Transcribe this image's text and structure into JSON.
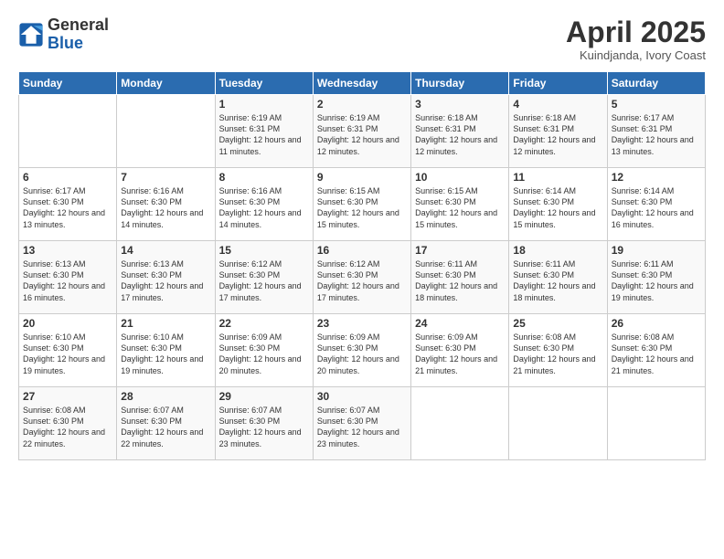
{
  "header": {
    "logo_general": "General",
    "logo_blue": "Blue",
    "month_title": "April 2025",
    "location": "Kuindjanda, Ivory Coast"
  },
  "days_of_week": [
    "Sunday",
    "Monday",
    "Tuesday",
    "Wednesday",
    "Thursday",
    "Friday",
    "Saturday"
  ],
  "weeks": [
    [
      {
        "day": "",
        "info": ""
      },
      {
        "day": "",
        "info": ""
      },
      {
        "day": "1",
        "info": "Sunrise: 6:19 AM\nSunset: 6:31 PM\nDaylight: 12 hours and 11 minutes."
      },
      {
        "day": "2",
        "info": "Sunrise: 6:19 AM\nSunset: 6:31 PM\nDaylight: 12 hours and 12 minutes."
      },
      {
        "day": "3",
        "info": "Sunrise: 6:18 AM\nSunset: 6:31 PM\nDaylight: 12 hours and 12 minutes."
      },
      {
        "day": "4",
        "info": "Sunrise: 6:18 AM\nSunset: 6:31 PM\nDaylight: 12 hours and 12 minutes."
      },
      {
        "day": "5",
        "info": "Sunrise: 6:17 AM\nSunset: 6:31 PM\nDaylight: 12 hours and 13 minutes."
      }
    ],
    [
      {
        "day": "6",
        "info": "Sunrise: 6:17 AM\nSunset: 6:30 PM\nDaylight: 12 hours and 13 minutes."
      },
      {
        "day": "7",
        "info": "Sunrise: 6:16 AM\nSunset: 6:30 PM\nDaylight: 12 hours and 14 minutes."
      },
      {
        "day": "8",
        "info": "Sunrise: 6:16 AM\nSunset: 6:30 PM\nDaylight: 12 hours and 14 minutes."
      },
      {
        "day": "9",
        "info": "Sunrise: 6:15 AM\nSunset: 6:30 PM\nDaylight: 12 hours and 15 minutes."
      },
      {
        "day": "10",
        "info": "Sunrise: 6:15 AM\nSunset: 6:30 PM\nDaylight: 12 hours and 15 minutes."
      },
      {
        "day": "11",
        "info": "Sunrise: 6:14 AM\nSunset: 6:30 PM\nDaylight: 12 hours and 15 minutes."
      },
      {
        "day": "12",
        "info": "Sunrise: 6:14 AM\nSunset: 6:30 PM\nDaylight: 12 hours and 16 minutes."
      }
    ],
    [
      {
        "day": "13",
        "info": "Sunrise: 6:13 AM\nSunset: 6:30 PM\nDaylight: 12 hours and 16 minutes."
      },
      {
        "day": "14",
        "info": "Sunrise: 6:13 AM\nSunset: 6:30 PM\nDaylight: 12 hours and 17 minutes."
      },
      {
        "day": "15",
        "info": "Sunrise: 6:12 AM\nSunset: 6:30 PM\nDaylight: 12 hours and 17 minutes."
      },
      {
        "day": "16",
        "info": "Sunrise: 6:12 AM\nSunset: 6:30 PM\nDaylight: 12 hours and 17 minutes."
      },
      {
        "day": "17",
        "info": "Sunrise: 6:11 AM\nSunset: 6:30 PM\nDaylight: 12 hours and 18 minutes."
      },
      {
        "day": "18",
        "info": "Sunrise: 6:11 AM\nSunset: 6:30 PM\nDaylight: 12 hours and 18 minutes."
      },
      {
        "day": "19",
        "info": "Sunrise: 6:11 AM\nSunset: 6:30 PM\nDaylight: 12 hours and 19 minutes."
      }
    ],
    [
      {
        "day": "20",
        "info": "Sunrise: 6:10 AM\nSunset: 6:30 PM\nDaylight: 12 hours and 19 minutes."
      },
      {
        "day": "21",
        "info": "Sunrise: 6:10 AM\nSunset: 6:30 PM\nDaylight: 12 hours and 19 minutes."
      },
      {
        "day": "22",
        "info": "Sunrise: 6:09 AM\nSunset: 6:30 PM\nDaylight: 12 hours and 20 minutes."
      },
      {
        "day": "23",
        "info": "Sunrise: 6:09 AM\nSunset: 6:30 PM\nDaylight: 12 hours and 20 minutes."
      },
      {
        "day": "24",
        "info": "Sunrise: 6:09 AM\nSunset: 6:30 PM\nDaylight: 12 hours and 21 minutes."
      },
      {
        "day": "25",
        "info": "Sunrise: 6:08 AM\nSunset: 6:30 PM\nDaylight: 12 hours and 21 minutes."
      },
      {
        "day": "26",
        "info": "Sunrise: 6:08 AM\nSunset: 6:30 PM\nDaylight: 12 hours and 21 minutes."
      }
    ],
    [
      {
        "day": "27",
        "info": "Sunrise: 6:08 AM\nSunset: 6:30 PM\nDaylight: 12 hours and 22 minutes."
      },
      {
        "day": "28",
        "info": "Sunrise: 6:07 AM\nSunset: 6:30 PM\nDaylight: 12 hours and 22 minutes."
      },
      {
        "day": "29",
        "info": "Sunrise: 6:07 AM\nSunset: 6:30 PM\nDaylight: 12 hours and 23 minutes."
      },
      {
        "day": "30",
        "info": "Sunrise: 6:07 AM\nSunset: 6:30 PM\nDaylight: 12 hours and 23 minutes."
      },
      {
        "day": "",
        "info": ""
      },
      {
        "day": "",
        "info": ""
      },
      {
        "day": "",
        "info": ""
      }
    ]
  ]
}
